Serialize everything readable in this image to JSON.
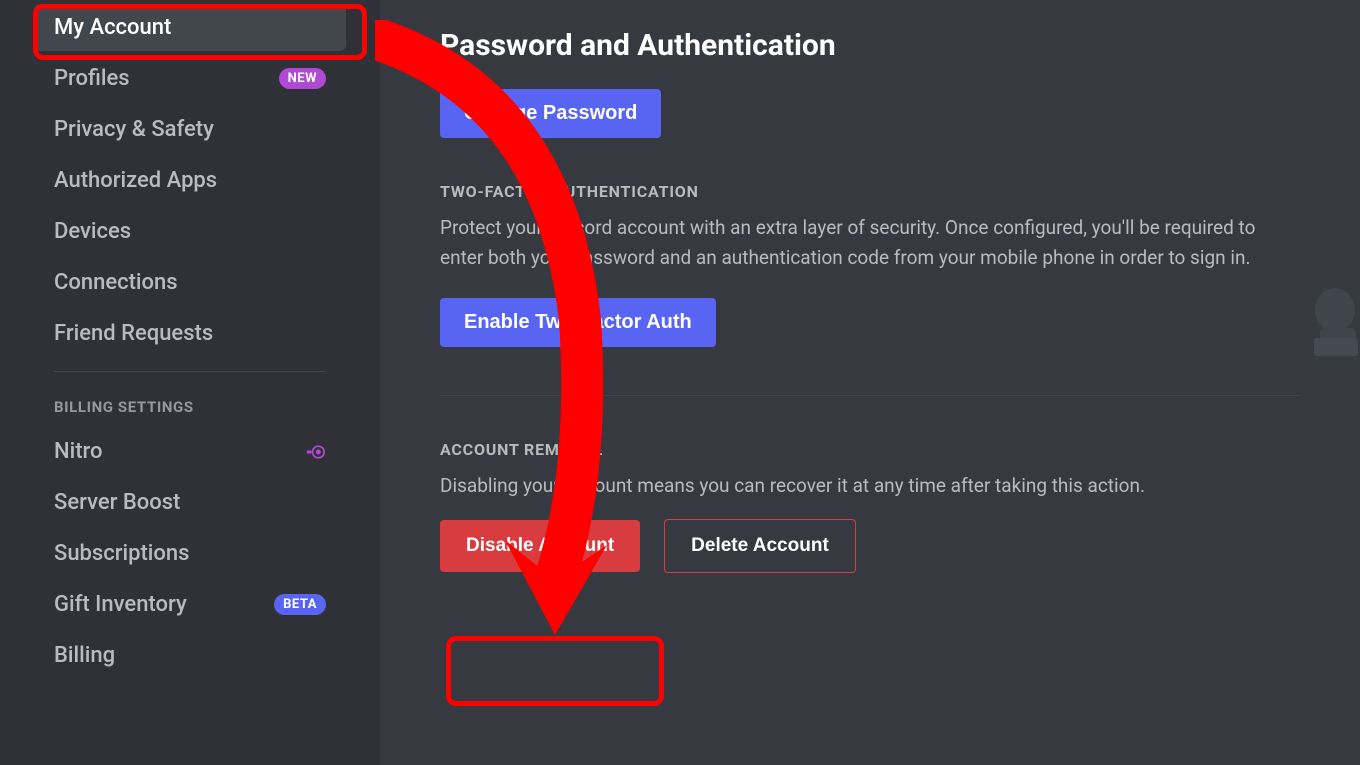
{
  "sidebar": {
    "items_user": [
      {
        "label": "My Account",
        "badge": null,
        "active": true
      },
      {
        "label": "Profiles",
        "badge": "NEW",
        "active": false
      },
      {
        "label": "Privacy & Safety",
        "badge": null,
        "active": false
      },
      {
        "label": "Authorized Apps",
        "badge": null,
        "active": false
      },
      {
        "label": "Devices",
        "badge": null,
        "active": false
      },
      {
        "label": "Connections",
        "badge": null,
        "active": false
      },
      {
        "label": "Friend Requests",
        "badge": null,
        "active": false
      }
    ],
    "billing_header": "BILLING SETTINGS",
    "items_billing": [
      {
        "label": "Nitro",
        "badge": null,
        "icon": "nitro"
      },
      {
        "label": "Server Boost",
        "badge": null
      },
      {
        "label": "Subscriptions",
        "badge": null
      },
      {
        "label": "Gift Inventory",
        "badge": "BETA"
      },
      {
        "label": "Billing",
        "badge": null
      }
    ]
  },
  "main": {
    "title": "Password and Authentication",
    "change_password_button": "Change Password",
    "twofa": {
      "label": "TWO-FACTOR AUTHENTICATION",
      "description": "Protect your Discord account with an extra layer of security. Once configured, you'll be required to enter both your password and an authentication code from your mobile phone in order to sign in.",
      "button": "Enable Two-Factor Auth"
    },
    "removal": {
      "label": "ACCOUNT REMOVAL",
      "description": "Disabling your account means you can recover it at any time after taking this action.",
      "disable_button": "Disable Account",
      "delete_button": "Delete Account"
    }
  },
  "annotations": {
    "highlight_my_account": true,
    "highlight_disable": true,
    "arrow": true
  }
}
